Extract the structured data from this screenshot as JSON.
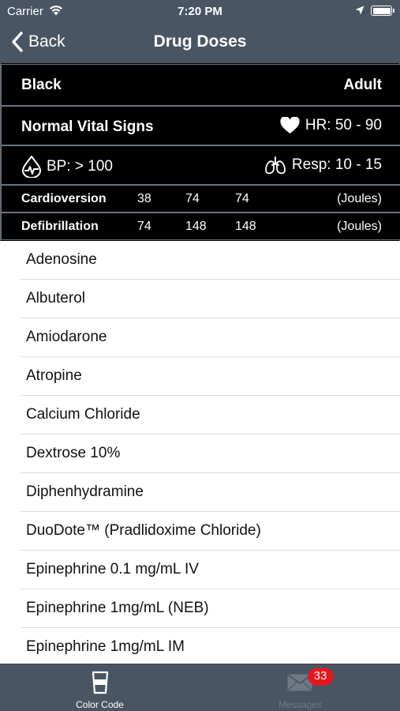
{
  "status_bar": {
    "carrier": "Carrier",
    "time": "7:20 PM"
  },
  "nav": {
    "back_label": "Back",
    "title": "Drug Doses"
  },
  "panel": {
    "color_name": "Black",
    "age_group": "Adult",
    "vitals_title": "Normal Vital Signs",
    "hr": "HR: 50 - 90",
    "bp": "BP: > 100",
    "resp": "Resp: 10 - 15",
    "cardioversion": {
      "label": "Cardioversion",
      "values": [
        "38",
        "74",
        "74"
      ],
      "unit": "(Joules)"
    },
    "defibrillation": {
      "label": "Defibrillation",
      "values": [
        "74",
        "148",
        "148"
      ],
      "unit": "(Joules)"
    }
  },
  "drugs": [
    "Adenosine",
    "Albuterol",
    "Amiodarone",
    "Atropine",
    "Calcium Chloride",
    "Dextrose 10%",
    "Diphenhydramine",
    "DuoDote™ (Pradlidoxime Chloride)",
    "Epinephrine 0.1 mg/mL IV",
    "Epinephrine 1mg/mL (NEB)",
    "Epinephrine 1mg/mL IM"
  ],
  "tabs": [
    {
      "label": "Color Code",
      "icon": "cup-icon",
      "active": true
    },
    {
      "label": "Messages",
      "icon": "envelope-icon",
      "badge": "33",
      "active": false
    }
  ]
}
